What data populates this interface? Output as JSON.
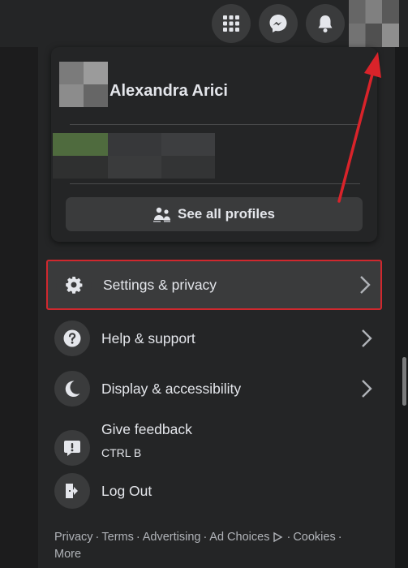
{
  "topbar": {
    "icons": [
      "apps-grid-icon",
      "messenger-icon",
      "bell-icon"
    ]
  },
  "profile": {
    "name": "Alexandra Arici",
    "see_all_label": "See all profiles"
  },
  "menu": {
    "items": [
      {
        "label": "Settings & privacy",
        "icon": "gear-icon",
        "chevron": true
      },
      {
        "label": "Help & support",
        "icon": "question-icon",
        "chevron": true
      },
      {
        "label": "Display & accessibility",
        "icon": "moon-icon",
        "chevron": true
      },
      {
        "label": "Give feedback",
        "sublabel": "CTRL B",
        "icon": "feedback-icon",
        "chevron": false
      },
      {
        "label": "Log Out",
        "icon": "logout-icon",
        "chevron": false
      }
    ]
  },
  "footer": {
    "links": [
      "Privacy",
      "Terms",
      "Advertising",
      "Ad Choices",
      "Cookies",
      "More"
    ]
  },
  "colors": {
    "background": "#18191a",
    "panel": "#242526",
    "button": "#3a3b3c",
    "highlight_border": "#d0282e",
    "annotation_arrow": "#d9232a"
  }
}
